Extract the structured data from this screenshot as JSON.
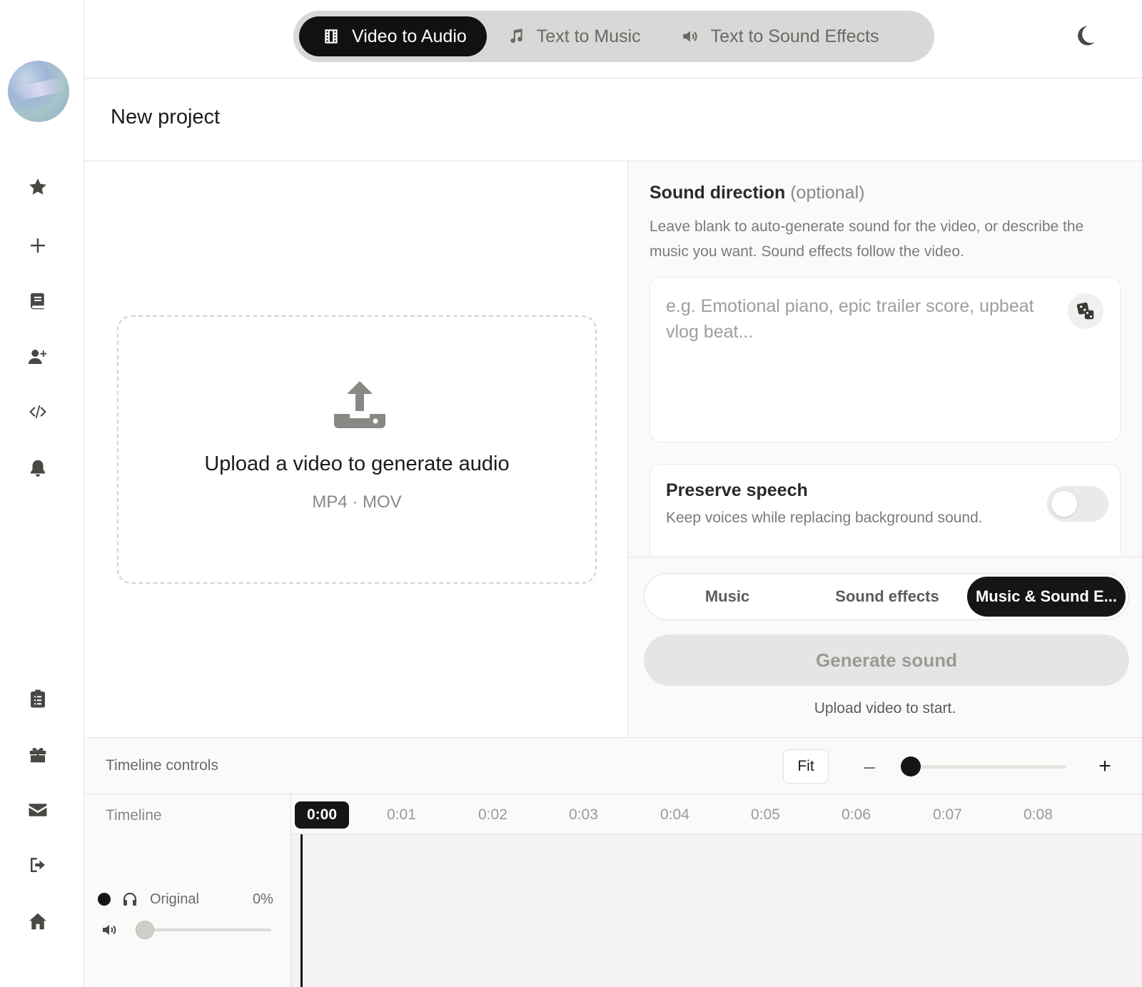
{
  "app": {
    "modes": [
      {
        "label": "Video to Audio",
        "icon": "film-icon",
        "active": true
      },
      {
        "label": "Text to Music",
        "icon": "music-note-icon",
        "active": false
      },
      {
        "label": "Text to Sound Effects",
        "icon": "speaker-icon",
        "active": false
      }
    ],
    "theme_toggle_icon": "moon-icon"
  },
  "sidebar": {
    "top_items": [
      "star-icon",
      "plus-icon",
      "book-icon",
      "add-user-icon",
      "code-icon",
      "bell-icon"
    ],
    "bottom_items": [
      "clipboard-icon",
      "gift-icon",
      "mail-icon",
      "sign-out-icon",
      "home-icon"
    ]
  },
  "project": {
    "title": "New project"
  },
  "upload": {
    "title": "Upload a video to generate audio",
    "formats": "MP4 · MOV"
  },
  "sound_direction": {
    "title": "Sound direction",
    "optional_label": "(optional)",
    "description": "Leave blank to auto-generate sound for the video, or describe the music you want. Sound effects follow the video.",
    "placeholder": "e.g. Emotional piano, epic trailer score, upbeat vlog beat..."
  },
  "preserve_speech": {
    "title": "Preserve speech",
    "description": "Keep voices while replacing background sound.",
    "enabled": false
  },
  "output_type": {
    "options": [
      "Music",
      "Sound effects",
      "Music & Sound E..."
    ],
    "selected": "Music & Sound E..."
  },
  "generate": {
    "label": "Generate sound",
    "hint": "Upload video to start.",
    "disabled": true
  },
  "timeline_controls": {
    "label": "Timeline controls",
    "fit_label": "Fit",
    "zoom_out_label": "–",
    "zoom_in_label": "+",
    "zoom_level": 0
  },
  "timeline": {
    "title": "Timeline",
    "ticks": [
      "0:00",
      "0:01",
      "0:02",
      "0:03",
      "0:04",
      "0:05",
      "0:06",
      "0:07",
      "0:08"
    ],
    "current_time": "0:00",
    "tracks": [
      {
        "name": "Original",
        "volume": "0%",
        "volume_value": 0
      }
    ]
  },
  "colors": {
    "accent": "#111111",
    "background": "#ffffff",
    "panel": "#fafaf9",
    "muted_text": "#8a8885"
  }
}
